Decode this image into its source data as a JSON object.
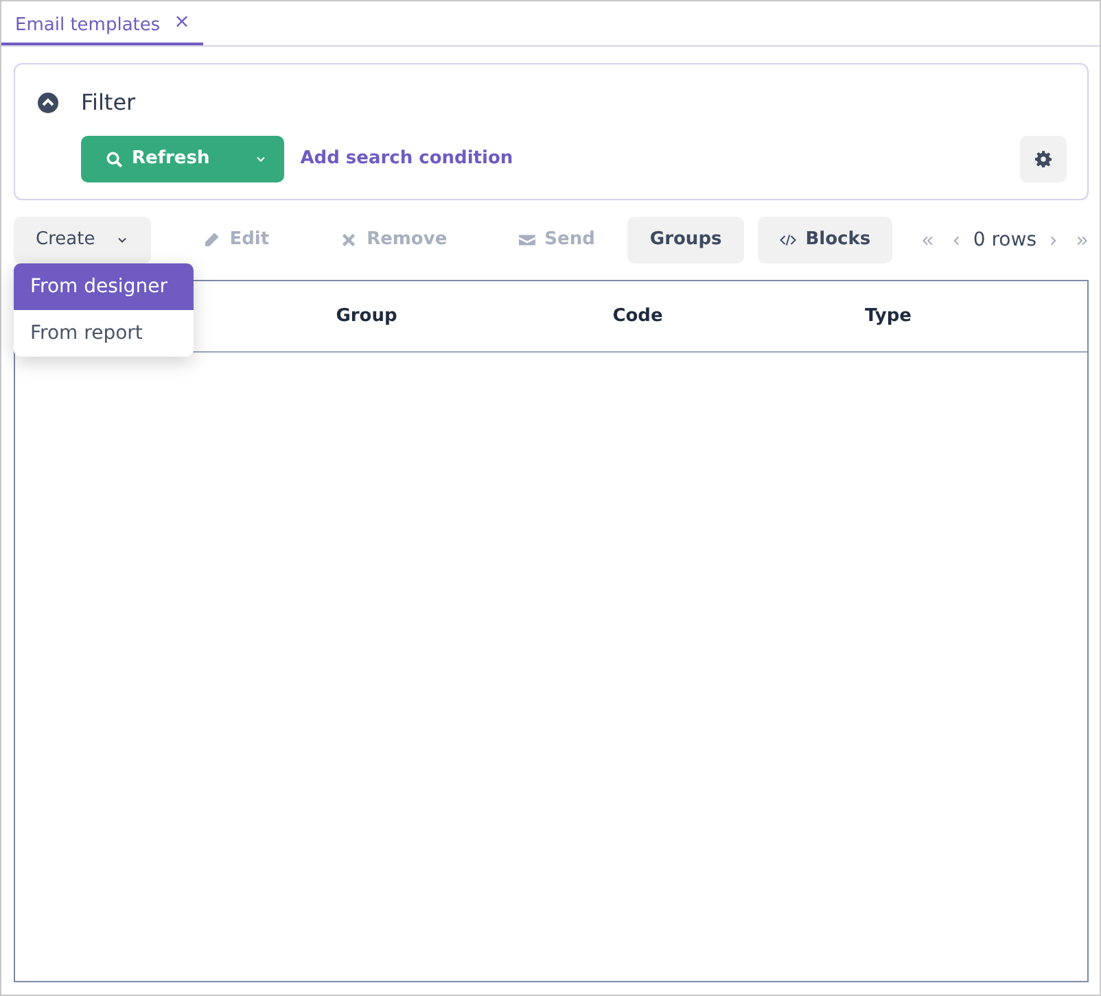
{
  "tabs": [
    {
      "label": "Email templates",
      "selected": true,
      "close": "×"
    }
  ],
  "filter": {
    "expanded": true,
    "label": "Filter",
    "refresh_button": "Refresh",
    "add_condition_link": "Add search condition"
  },
  "toolbar": [
    {
      "kind": "dropdown",
      "label": "Create",
      "disabled": false
    },
    {
      "kind": "plain",
      "label": "Edit",
      "disabled": true
    },
    {
      "kind": "plain",
      "label": "Remove",
      "disabled": true
    },
    {
      "kind": "plain",
      "label": "Send",
      "disabled": true
    },
    {
      "kind": "filled",
      "label": "Groups",
      "disabled": false
    },
    {
      "kind": "filled",
      "label": "Blocks",
      "disabled": false
    }
  ],
  "create_menu": [
    {
      "label": "From designer",
      "selected": true
    },
    {
      "label": "From report",
      "selected": false
    }
  ],
  "pagination": {
    "rows_label": "0 rows"
  },
  "table": {
    "columns": [
      {
        "label": "Group"
      },
      {
        "label": "Code"
      },
      {
        "label": "Type"
      }
    ]
  }
}
